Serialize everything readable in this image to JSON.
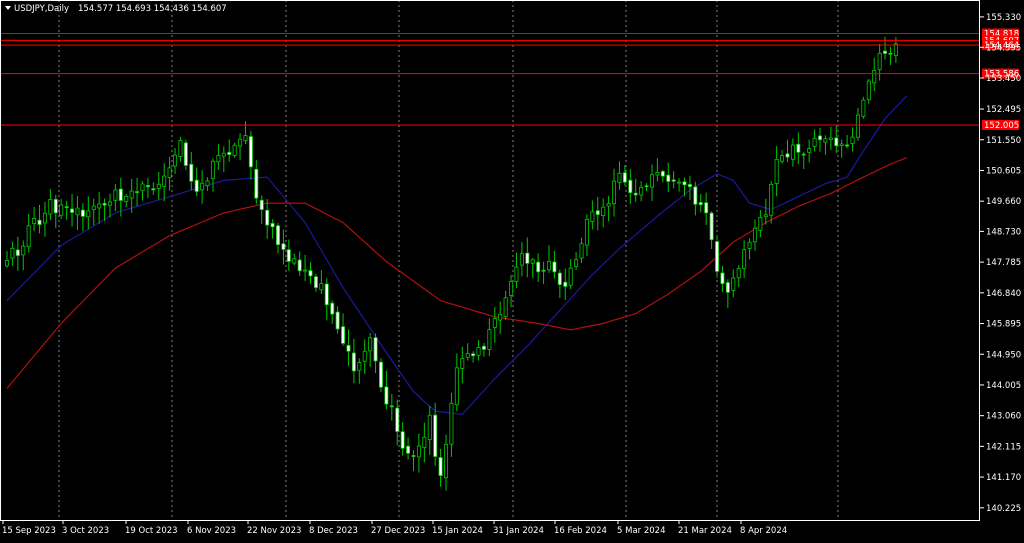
{
  "header": {
    "menu_icon": "triangle-down-icon",
    "symbol": "USDJPY,Daily",
    "ohlc": "154.577 154.693 154.436 154.607"
  },
  "colors": {
    "background": "#000000",
    "candle_border": "#00c800",
    "bull_body": "#000000",
    "bear_body": "#ffffff",
    "ma_fast": "#1a1a9e",
    "ma_slow": "#b01010",
    "level_line": "#ff0000",
    "grid": "#ffffff",
    "text": "#ffffff"
  },
  "chart_data": {
    "type": "candlestick",
    "x_tick_labels": [
      "15 Sep 2023",
      "3 Oct 2023",
      "19 Oct 2023",
      "6 Nov 2023",
      "22 Nov 2023",
      "8 Dec 2023",
      "27 Dec 2023",
      "15 Jan 2024",
      "31 Jan 2024",
      "16 Feb 2024",
      "5 Mar 2024",
      "21 Mar 2024",
      "8 Apr 2024"
    ],
    "y_tick_labels": [
      "155.330",
      "154.395",
      "153.450",
      "152.495",
      "151.550",
      "150.605",
      "149.660",
      "148.730",
      "147.785",
      "146.840",
      "145.895",
      "144.950",
      "144.005",
      "143.060",
      "142.115",
      "141.170",
      "140.225"
    ],
    "ylim": [
      139.85,
      155.85
    ],
    "grid": "vertical dashed",
    "levels": [
      {
        "label": "154.818",
        "value": 154.818
      },
      {
        "label": "154.607",
        "value": 154.607
      },
      {
        "label": "154.464",
        "value": 154.464
      },
      {
        "label": "153.586",
        "value": 153.586
      },
      {
        "label": "152.005",
        "value": 152.005
      }
    ],
    "series": [
      {
        "type": "candlestick",
        "price_anchors": [
          [
            0,
            147.7
          ],
          [
            8,
            149.6
          ],
          [
            13,
            149.2
          ],
          [
            20,
            149.8
          ],
          [
            28,
            150.1
          ],
          [
            32,
            151.6
          ],
          [
            35,
            149.9
          ],
          [
            40,
            151.1
          ],
          [
            44,
            151.5
          ],
          [
            46,
            149.6
          ],
          [
            50,
            148.4
          ],
          [
            54,
            147.6
          ],
          [
            58,
            147.1
          ],
          [
            64,
            144.5
          ],
          [
            67,
            145.5
          ],
          [
            70,
            143.5
          ],
          [
            73,
            142.3
          ],
          [
            76,
            141.9
          ],
          [
            78,
            142.8
          ],
          [
            80,
            141.3
          ],
          [
            83,
            144.5
          ],
          [
            86,
            144.9
          ],
          [
            89,
            145.6
          ],
          [
            92,
            146.8
          ],
          [
            95,
            148.2
          ],
          [
            97,
            147.8
          ],
          [
            100,
            147.6
          ],
          [
            103,
            146.9
          ],
          [
            106,
            148.4
          ],
          [
            108,
            149.3
          ],
          [
            111,
            149.6
          ],
          [
            113,
            150.5
          ],
          [
            116,
            150.0
          ],
          [
            118,
            150.2
          ],
          [
            121,
            150.5
          ],
          [
            124,
            150.4
          ],
          [
            126,
            150.1
          ],
          [
            128,
            149.4
          ],
          [
            130,
            148.7
          ],
          [
            131,
            147.5
          ],
          [
            133,
            146.7
          ],
          [
            135,
            147.6
          ],
          [
            137,
            148.5
          ],
          [
            140,
            149.4
          ],
          [
            142,
            150.8
          ],
          [
            145,
            151.3
          ],
          [
            148,
            151.3
          ],
          [
            151,
            151.4
          ],
          [
            153,
            151.5
          ],
          [
            155,
            151.6
          ],
          [
            157,
            152.2
          ],
          [
            159,
            153.2
          ],
          [
            160,
            153.9
          ],
          [
            162,
            154.3
          ],
          [
            164,
            154.6
          ]
        ]
      },
      {
        "type": "ma",
        "color_key": "ma_fast",
        "anchors": [
          [
            0,
            146.6
          ],
          [
            10,
            148.3
          ],
          [
            20,
            149.3
          ],
          [
            30,
            149.8
          ],
          [
            40,
            150.3
          ],
          [
            48,
            150.4
          ],
          [
            55,
            149.0
          ],
          [
            62,
            147.0
          ],
          [
            70,
            145.0
          ],
          [
            75,
            143.8
          ],
          [
            79,
            143.2
          ],
          [
            84,
            143.1
          ],
          [
            90,
            144.2
          ],
          [
            96,
            145.2
          ],
          [
            102,
            146.3
          ],
          [
            108,
            147.4
          ],
          [
            113,
            148.2
          ],
          [
            120,
            149.2
          ],
          [
            126,
            150.0
          ],
          [
            131,
            150.5
          ],
          [
            134,
            150.3
          ],
          [
            137,
            149.6
          ],
          [
            141,
            149.4
          ],
          [
            146,
            149.8
          ],
          [
            151,
            150.2
          ],
          [
            155,
            150.4
          ],
          [
            158,
            151.2
          ],
          [
            162,
            152.2
          ],
          [
            166,
            152.9
          ]
        ]
      },
      {
        "type": "ma",
        "color_key": "ma_slow",
        "anchors": [
          [
            0,
            143.9
          ],
          [
            10,
            145.9
          ],
          [
            20,
            147.6
          ],
          [
            30,
            148.6
          ],
          [
            40,
            149.3
          ],
          [
            48,
            149.6
          ],
          [
            55,
            149.6
          ],
          [
            62,
            149.0
          ],
          [
            70,
            147.8
          ],
          [
            80,
            146.6
          ],
          [
            90,
            146.1
          ],
          [
            98,
            145.9
          ],
          [
            104,
            145.7
          ],
          [
            110,
            145.9
          ],
          [
            116,
            146.2
          ],
          [
            122,
            146.8
          ],
          [
            128,
            147.5
          ],
          [
            134,
            148.4
          ],
          [
            140,
            149.0
          ],
          [
            146,
            149.5
          ],
          [
            152,
            149.9
          ],
          [
            158,
            150.4
          ],
          [
            163,
            150.8
          ],
          [
            166,
            151.0
          ]
        ]
      }
    ]
  }
}
